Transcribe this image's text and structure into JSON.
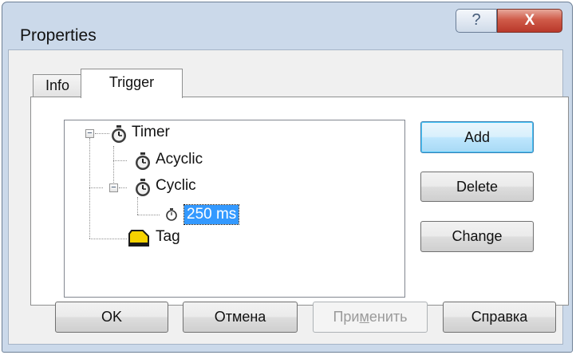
{
  "window": {
    "title": "Properties",
    "help_glyph": "?",
    "close_glyph": "X"
  },
  "tabs": [
    {
      "label": "Info",
      "active": false
    },
    {
      "label": "Trigger",
      "active": true
    }
  ],
  "tree": {
    "nodes": [
      {
        "id": "timer",
        "label": "Timer",
        "icon": "stopwatch-icon",
        "expanded": true
      },
      {
        "id": "acyclic",
        "label": "Acyclic",
        "icon": "stopwatch-icon"
      },
      {
        "id": "cyclic",
        "label": "Cyclic",
        "icon": "stopwatch-icon",
        "expanded": true
      },
      {
        "id": "interval",
        "label": "250 ms",
        "icon": "small-clock-icon",
        "selected": true
      },
      {
        "id": "tag",
        "label": "Tag",
        "icon": "yellow-tag-icon"
      }
    ],
    "expander_collapse": "−"
  },
  "side_buttons": {
    "add": "Add",
    "delete": "Delete",
    "change": "Change"
  },
  "footer_buttons": {
    "ok": "OK",
    "cancel": "Отмена",
    "apply_pre": "При",
    "apply_ul": "м",
    "apply_post": "енить",
    "help": "Справка"
  },
  "colors": {
    "selection": "#3399ff",
    "window_frame": "#cbd9ea",
    "close_button": "#c9493a",
    "tag_icon": "#f7d300"
  }
}
